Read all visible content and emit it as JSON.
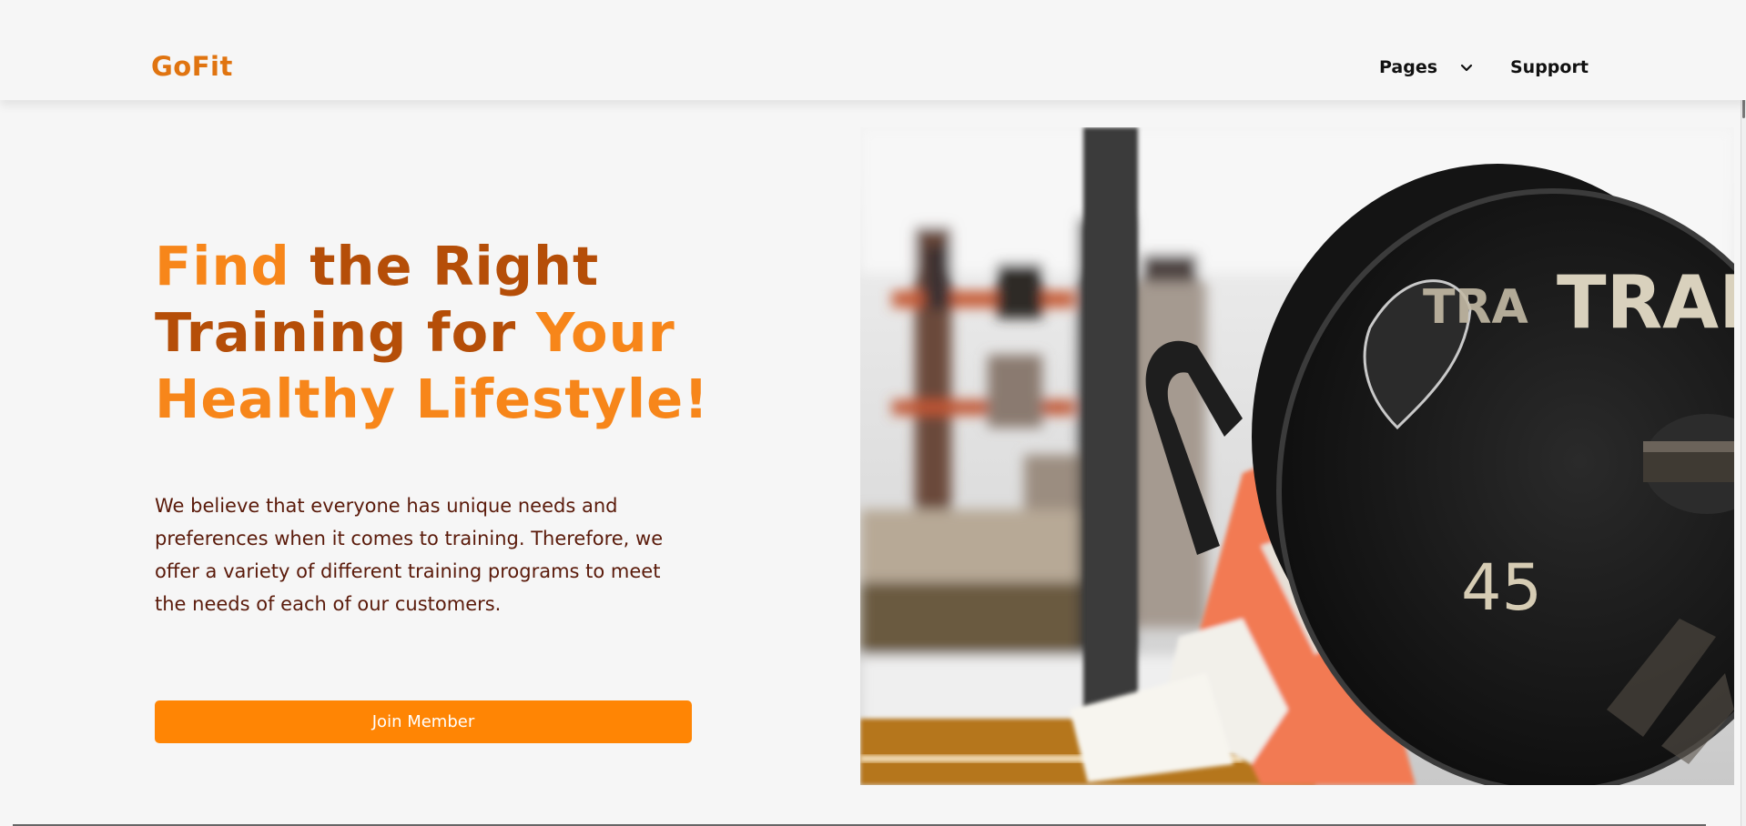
{
  "brand": {
    "logo": "GoFit"
  },
  "nav": {
    "pages_label": "Pages",
    "support_label": "Support"
  },
  "hero": {
    "headline": {
      "line1_a": "Find",
      "line1_b": " the Right",
      "line2_a": "Training for ",
      "line2_b": "Your",
      "line3": "Healthy Lifestyle!"
    },
    "description": "We believe that everyone has unique needs and preferences when it comes to training. Therefore, we offer a variety of different training programs to meet the needs of each of our customers.",
    "cta_label": "Join Member",
    "image": {
      "plate_text": "TRAIN",
      "plate_text_partial": "TRA",
      "plate_weight": "45"
    }
  },
  "colors": {
    "accent": "#ff8504",
    "accent_light": "#f7861a",
    "accent_dark": "#b54e08",
    "logo": "#e07410",
    "body_text": "#5a1a0a",
    "background": "#f6f6f6"
  },
  "icons": {
    "nav_dropdown": "chevron-down-icon"
  }
}
